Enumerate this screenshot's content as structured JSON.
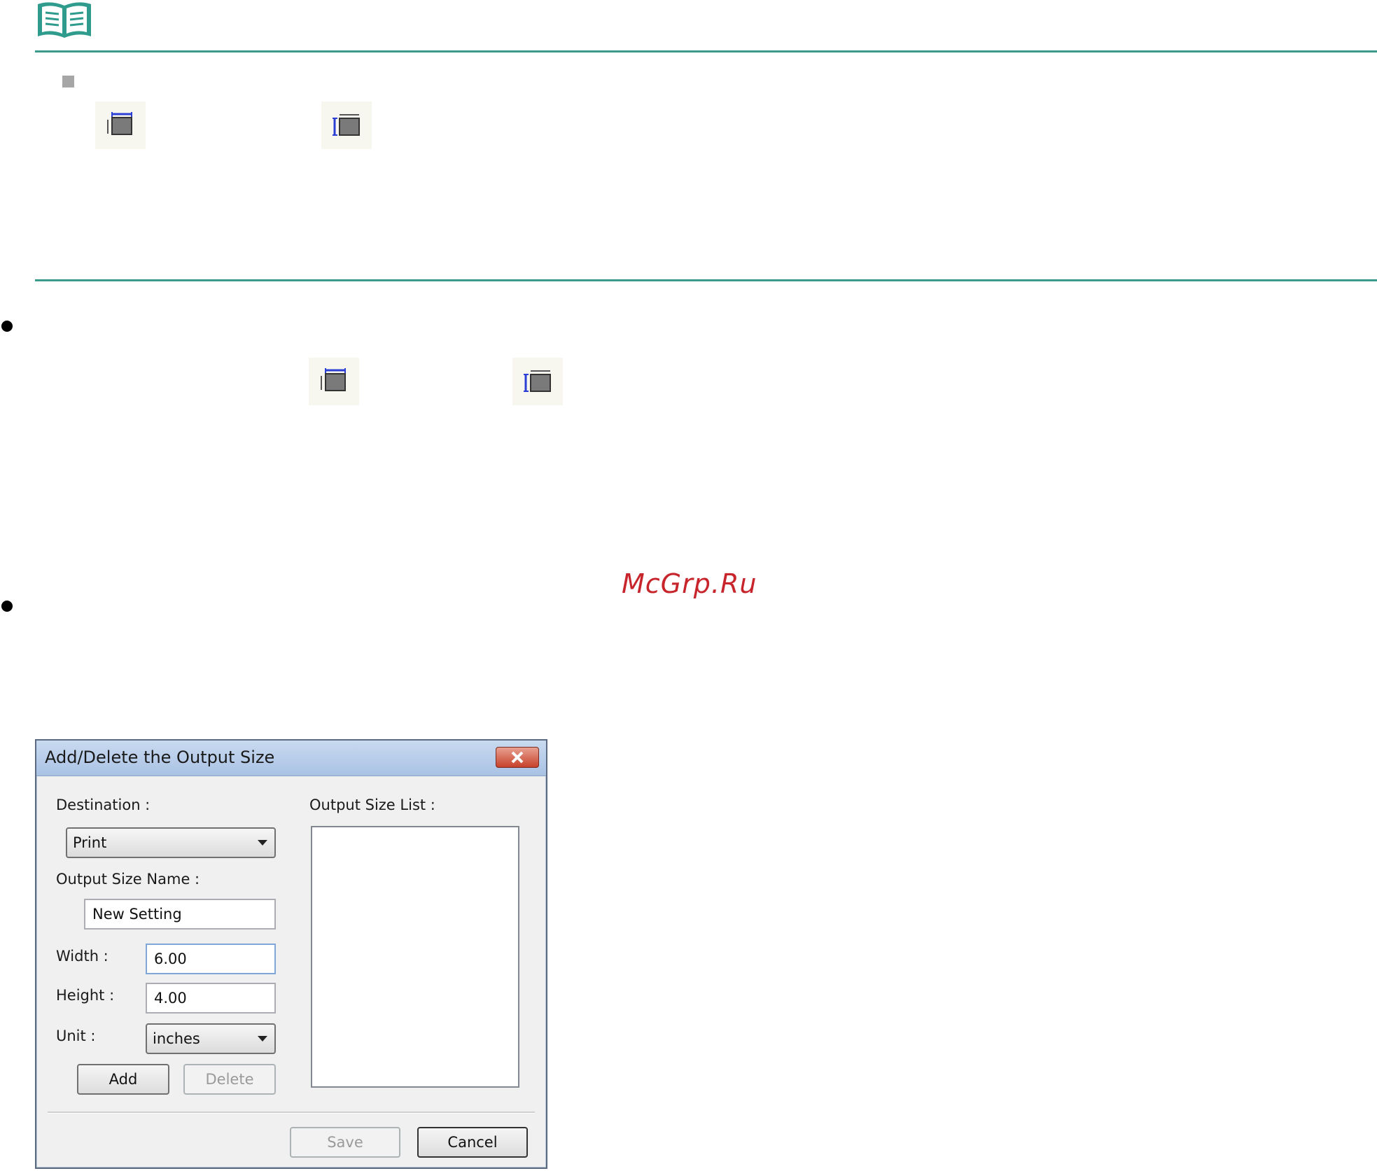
{
  "document": {
    "icons": {
      "note": "open-book-icon",
      "tool": "crop-frame-icon"
    }
  },
  "watermark": "McGrp.Ru",
  "dialog": {
    "title": "Add/Delete the Output Size",
    "close_icon": "close-x-icon",
    "destination": {
      "label": "Destination :",
      "value": "Print"
    },
    "output_size_name": {
      "label": "Output Size Name :",
      "value": "New Setting"
    },
    "width": {
      "label": "Width :",
      "value": "6.00"
    },
    "height": {
      "label": "Height :",
      "value": "4.00"
    },
    "unit": {
      "label": "Unit :",
      "value": "inches"
    },
    "output_size_list": {
      "label": "Output Size List :",
      "items": []
    },
    "buttons": {
      "add": "Add",
      "delete": "Delete",
      "save": "Save",
      "cancel": "Cancel"
    },
    "colors": {
      "titlebar": "#b4cbe8",
      "close": "#c7412a",
      "rule": "#3a9a8c"
    }
  }
}
